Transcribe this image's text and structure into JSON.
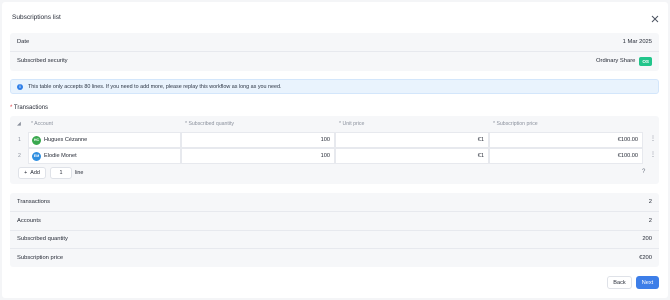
{
  "modal": {
    "title": "Subscriptions list"
  },
  "details": {
    "date_label": "Date",
    "date_value": "1 Mar 2025",
    "security_label": "Subscribed security",
    "security_value": "Ordinary Share",
    "security_tag": "OS"
  },
  "info": {
    "text": "This table only accepts 80 lines. If you need to add more, please replay this workflow as long as you need."
  },
  "transactions": {
    "title": "Transactions",
    "required_mark": "*",
    "headers": {
      "sort": "◢",
      "account": "* Account",
      "quantity": "* Subscribed quantity",
      "unit_price": "* Unit price",
      "subscription_price": "* Subscription price"
    },
    "rows": [
      {
        "index": "1",
        "initials": "HC",
        "avatar_color": "#3aa84f",
        "account": "Hugues Cézanne",
        "quantity": "100",
        "unit_price": "€1",
        "subscription_price": "€100.00"
      },
      {
        "index": "2",
        "initials": "EM",
        "avatar_color": "#2f8fe0",
        "account": "Elodie Monet",
        "quantity": "100",
        "unit_price": "€1",
        "subscription_price": "€100.00"
      }
    ],
    "add_label": "Add",
    "add_count": "1",
    "line_label": "line",
    "help": "?"
  },
  "summary": [
    {
      "label": "Transactions",
      "value": "2"
    },
    {
      "label": "Accounts",
      "value": "2"
    },
    {
      "label": "Subscribed quantity",
      "value": "200"
    },
    {
      "label": "Subscription price",
      "value": "€200"
    }
  ],
  "footer": {
    "back_label": "Back",
    "next_label": "Next"
  }
}
